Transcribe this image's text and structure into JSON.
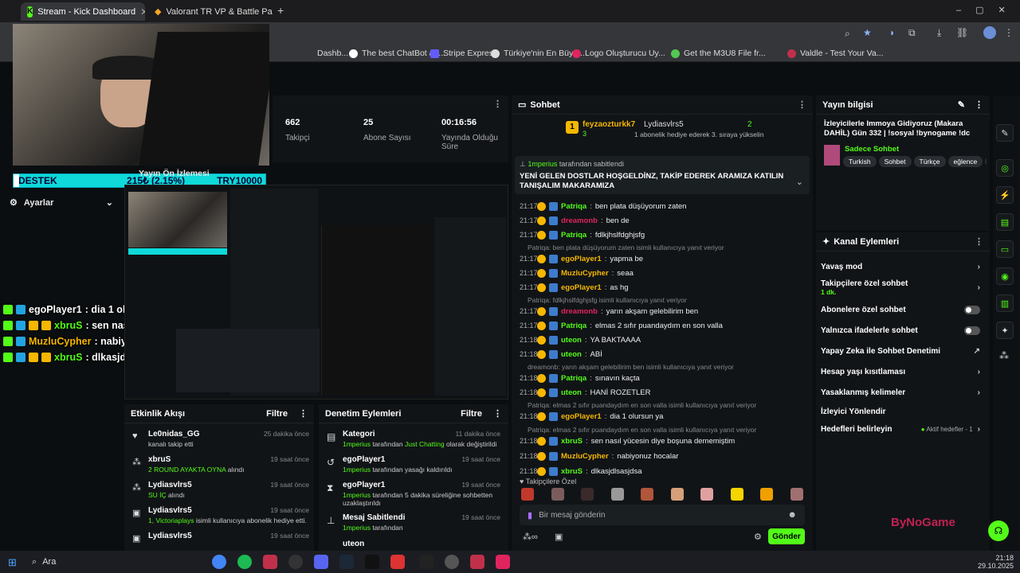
{
  "tabs": [
    {
      "label": "Stream - Kick Dashboard"
    },
    {
      "label": "Valorant TR VP & Battle Pass Sa"
    }
  ],
  "bookmarks": [
    "Dashb...",
    "The best ChatBot an...",
    "Stripe Express",
    "Türkiye'nin En Büyü...",
    "Logo Oluşturucu Uy...",
    "Get the M3U8 File fr...",
    "Valdle - Test Your Va..."
  ],
  "stats": [
    {
      "value": "662",
      "label": "Takipçi"
    },
    {
      "value": "25",
      "label": "Abone Sayısı"
    },
    {
      "value": "00:16:56",
      "label": "Yayında Olduğu Süre"
    }
  ],
  "destek": {
    "label": "DESTEK",
    "amount": "215₺ (2.15%)",
    "goal": "TRY10000"
  },
  "left_menu": {
    "preview": "Yayın Ön İzlemesi",
    "settings": "Ayarlar"
  },
  "overlay_chat": [
    {
      "user": "egoPlayer1",
      "msg": ": dia 1 olursun ya"
    },
    {
      "user": "xbruS",
      "msg": ": sen nasıl yücesin diye boşuna dememiştim"
    },
    {
      "user": "MuzluCypher",
      "msg": ": nabiyonuz hocalar"
    },
    {
      "user": "xbruS",
      "msg": ": dlkasjdlsasjdsa"
    }
  ],
  "chat": {
    "title": "Sohbet",
    "top_user": {
      "name": "feyzaozturkk7",
      "count": "3"
    },
    "second_user": {
      "name": "Lydiasvlrs5",
      "count": "2",
      "note": "1 abonelik hediye ederek 3. sıraya yükselin"
    },
    "pinned_by": "1mperius",
    "pinned_suffix": "tarafından sabitlendi",
    "pinned_msg": "YENİ GELEN DOSTLAR HOŞGELDİNZ, TAKİP EDEREK ARAMIZA KATILIN TANIŞALIM MAKARAMIZA",
    "messages": [
      {
        "time": "21:17",
        "user": "Patriqa",
        "color": "#53fc18",
        "msg": "ben plata düşüyorum zaten"
      },
      {
        "time": "21:17",
        "user": "dreamonb",
        "color": "#e0245e",
        "msg": "ben de"
      },
      {
        "time": "21:17",
        "user": "Patriqa",
        "color": "#53fc18",
        "msg": "fdlkjhslfdghjsfg"
      },
      {
        "reply": "Patriqa: ben plata düşüyorum zaten isimli kullanıcıya yanıt veriyor"
      },
      {
        "time": "21:17",
        "user": "egoPlayer1",
        "color": "#f5b700",
        "msg": "yapma be"
      },
      {
        "time": "21:17",
        "user": "MuzluCypher",
        "color": "#f5b700",
        "msg": "seaa"
      },
      {
        "time": "21:17",
        "user": "egoPlayer1",
        "color": "#f5b700",
        "msg": "as hg"
      },
      {
        "reply": "Patriqa: fdlkjhslfdghjsfg isimli kullanıcıya yanıt veriyor"
      },
      {
        "time": "21:17",
        "user": "dreamonb",
        "color": "#e0245e",
        "msg": "yarın akşam gelebilirim ben"
      },
      {
        "time": "21:17",
        "user": "Patriqa",
        "color": "#53fc18",
        "msg": "elmas 2 sıfır puandaydım en son valla"
      },
      {
        "time": "21:18",
        "user": "uteon",
        "color": "#53fc18",
        "msg": "YA BAKTAAAA"
      },
      {
        "time": "21:18",
        "user": "uteon",
        "color": "#53fc18",
        "msg": "ABİ"
      },
      {
        "reply": "dreamonb: yarın akşam gelebilirim ben isimli kullanıcıya yanıt veriyor"
      },
      {
        "time": "21:18",
        "user": "Patriqa",
        "color": "#53fc18",
        "msg": "sınavın kaçta"
      },
      {
        "time": "21:18",
        "user": "uteon",
        "color": "#53fc18",
        "msg": "HANİ ROZETLER"
      },
      {
        "reply": "Patriqa: elmas 2 sıfır puandaydım en son valla isimli kullanıcıya yanıt veriyor"
      },
      {
        "time": "21:18",
        "user": "egoPlayer1",
        "color": "#f5b700",
        "msg": "dia 1 olursun ya"
      },
      {
        "reply": "Patriqa: elmas 2 sıfır puandaydım en son valla isimli kullanıcıya yanıt veriyor"
      },
      {
        "time": "21:18",
        "user": "xbruS",
        "color": "#53fc18",
        "msg": "sen nasıl yücesin diye boşuna dememiştim"
      },
      {
        "time": "21:18",
        "user": "MuzluCypher",
        "color": "#f5b700",
        "msg": "nabiyonuz hocalar"
      },
      {
        "time": "21:18",
        "user": "xbruS",
        "color": "#53fc18",
        "msg": "dlkasjdlsasjdsa"
      }
    ],
    "emote_label": "Takipçilere Özel",
    "input_placeholder": "Bir mesaj gönderin",
    "send": "Gönder"
  },
  "stream_info": {
    "title": "Yayın bilgisi",
    "stream_title": "İzleyicilerle Immoya Gidiyoruz (Makara DAHİL) Gün 332 | !sosyal !bynogame !dc",
    "category": "Sadece Sohbet",
    "tags": [
      "Turkish",
      "Sohbet",
      "Türkçe",
      "eğlence",
      "fp"
    ]
  },
  "channel_actions": {
    "title": "Kanal Eylemleri",
    "items": [
      {
        "label": "Yavaş mod",
        "kind": "chev"
      },
      {
        "label": "Takipçilere özel sohbet",
        "sub": "1 dk.",
        "kind": "chev"
      },
      {
        "label": "Abonelere özel sohbet",
        "kind": "toggle"
      },
      {
        "label": "Yalnızca ifadelerle sohbet",
        "kind": "toggle"
      },
      {
        "label": "Yapay Zeka ile Sohbet Denetimi",
        "kind": "ext"
      },
      {
        "label": "Hesap yaşı kısıtlaması",
        "kind": "chev"
      },
      {
        "label": "Yasaklanmış kelimeler",
        "kind": "chev"
      },
      {
        "label": "İzleyici Yönlendir",
        "kind": "none"
      },
      {
        "label": "Hedefleri belirleyin",
        "kind": "chev",
        "extra": "Aktif hedefler - 1"
      }
    ]
  },
  "activity": {
    "title": "Etkinlik Akışı",
    "filter": "Filtre",
    "items": [
      {
        "name": "Le0nidas_GG",
        "time": "25 dakika önce",
        "desc": "kanalı takip etti",
        "hl": ""
      },
      {
        "name": "xbruS",
        "time": "19 saat önce",
        "hl": "2 ROUND AYAKTA OYNA",
        "desc": "alındı"
      },
      {
        "name": "Lydiasvlrs5",
        "time": "19 saat önce",
        "hl": "SU İÇ",
        "desc": "alındı"
      },
      {
        "name": "Lydiasvlrs5",
        "time": "19 saat önce",
        "hl": "1, Victoriaplays",
        "desc": "isimli kullanıcıya abonelik hediye etti."
      },
      {
        "name": "Lydiasvlrs5",
        "time": "19 saat önce",
        "hl": "",
        "desc": ""
      }
    ]
  },
  "moderation": {
    "title": "Denetim Eylemleri",
    "filter": "Filtre",
    "items": [
      {
        "name": "Kategori",
        "time": "11 dakika önce",
        "hl": "1mperius",
        "desc": "tarafından",
        "hl2": "Just Chatting",
        "desc2": "olarak değiştirildi"
      },
      {
        "name": "egoPlayer1",
        "time": "19 saat önce",
        "hl": "1mperius",
        "desc": "tarafından yasağı kaldırıldı",
        "hl2": "",
        "desc2": ""
      },
      {
        "name": "egoPlayer1",
        "time": "19 saat önce",
        "hl": "1mperius",
        "desc": "tarafından 5 dakika süreliğine sohbetten uzaklaştırıldı",
        "hl2": "",
        "desc2": ""
      },
      {
        "name": "Mesaj Sabitlendi",
        "time": "19 saat önce",
        "hl": "1mperius",
        "desc": "tarafından",
        "hl2": "",
        "desc2": ""
      },
      {
        "name": "uteon",
        "time": "",
        "hl": "",
        "desc": "",
        "hl2": "",
        "desc2": ""
      }
    ]
  },
  "taskbar": {
    "search": "Ara",
    "time": "21:18",
    "date": "29.10.2025"
  },
  "watermark": "ByNoGame"
}
